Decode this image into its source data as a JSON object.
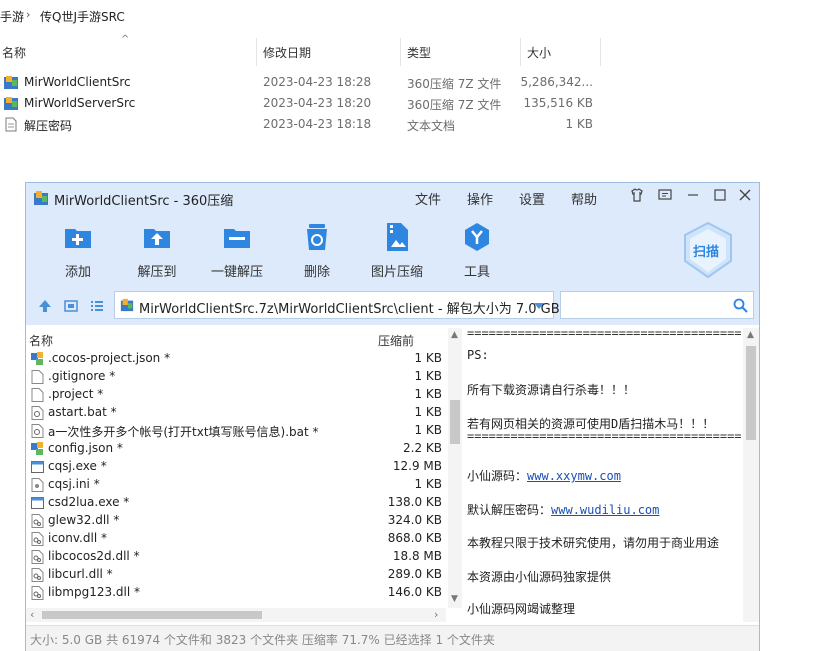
{
  "explorer": {
    "breadcrumb": [
      "手游",
      "传Q世J手游SRC"
    ],
    "columns": {
      "name": "名称",
      "date": "修改日期",
      "type": "类型",
      "size": "大小"
    },
    "files": [
      {
        "name": "MirWorldClientSrc",
        "date": "2023-04-23 18:28",
        "type": "360压缩 7Z 文件",
        "size": "5,286,342...",
        "icon": "360-archive-icon"
      },
      {
        "name": "MirWorldServerSrc",
        "date": "2023-04-23 18:20",
        "type": "360压缩 7Z 文件",
        "size": "135,516 KB",
        "icon": "360-archive-icon"
      },
      {
        "name": "解压密码",
        "date": "2023-04-23 18:18",
        "type": "文本文档",
        "size": "1 KB",
        "icon": "text-document-icon"
      }
    ]
  },
  "window": {
    "title": "MirWorldClientSrc - 360压缩",
    "menu": [
      "文件",
      "操作",
      "设置",
      "帮助"
    ],
    "toolbar": [
      {
        "label": "添加",
        "icon": "add-icon"
      },
      {
        "label": "解压到",
        "icon": "extract-to-icon"
      },
      {
        "label": "一键解压",
        "icon": "one-click-extract-icon"
      },
      {
        "label": "删除",
        "icon": "delete-icon"
      },
      {
        "label": "图片压缩",
        "icon": "image-compress-icon"
      },
      {
        "label": "工具",
        "icon": "tools-icon"
      }
    ],
    "scan_label": "扫描",
    "path": "MirWorldClientSrc.7z\\MirWorldClientSrc\\client - 解包大小为 7.0 GB",
    "search_placeholder": "",
    "list_header": {
      "name": "名称",
      "size": "压缩前"
    },
    "list": [
      {
        "name": ".cocos-project.json *",
        "size": "1 KB",
        "icon": "json-icon"
      },
      {
        "name": ".gitignore *",
        "size": "1 KB",
        "icon": "file-icon"
      },
      {
        "name": ".project *",
        "size": "1 KB",
        "icon": "file-icon"
      },
      {
        "name": "astart.bat *",
        "size": "1 KB",
        "icon": "bat-icon"
      },
      {
        "name": "a一次性多开多个帐号(打开txt填写账号信息).bat *",
        "size": "1 KB",
        "icon": "bat-icon"
      },
      {
        "name": "config.json *",
        "size": "2.2 KB",
        "icon": "json-icon"
      },
      {
        "name": "cqsj.exe *",
        "size": "12.9 MB",
        "icon": "exe-icon"
      },
      {
        "name": "cqsj.ini *",
        "size": "1 KB",
        "icon": "ini-icon"
      },
      {
        "name": "csd2lua.exe *",
        "size": "138.0 KB",
        "icon": "exe-icon"
      },
      {
        "name": "glew32.dll *",
        "size": "324.0 KB",
        "icon": "dll-icon"
      },
      {
        "name": "iconv.dll *",
        "size": "868.0 KB",
        "icon": "dll-icon"
      },
      {
        "name": "libcocos2d.dll *",
        "size": "18.8 MB",
        "icon": "dll-icon"
      },
      {
        "name": "libcurl.dll *",
        "size": "289.0 KB",
        "icon": "dll-icon"
      },
      {
        "name": "libmpg123.dll *",
        "size": "146.0 KB",
        "icon": "dll-icon"
      }
    ],
    "notes": {
      "separator": "======================================",
      "ps": "PS:",
      "line1": "所有下载资源请自行杀毒！！！",
      "line2": "若有网页相关的资源可使用D盾扫描木马！！！",
      "line3_label": "小仙源码：",
      "line3_link": "www.xxymw.com",
      "line4_label": "默认解压密码：",
      "line4_link": "www.wudiliu.com",
      "line5": "本教程只限于技术研究使用，请勿用于商业用途",
      "line6": "本资源由小仙源码独家提供",
      "line7": "小仙源码网竭诚整理"
    },
    "status": "大小: 5.0 GB 共 61974 个文件和 3823 个文件夹 压缩率 71.7% 已经选择 1 个文件夹"
  }
}
